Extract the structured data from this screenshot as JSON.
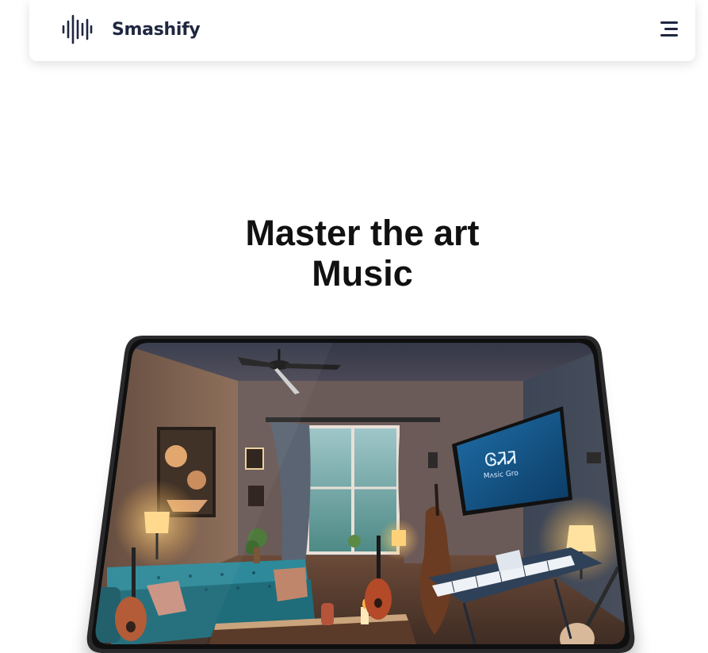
{
  "navbar": {
    "brand": "Smashify",
    "logo_icon": "sound-wave-icon",
    "menu_icon": "hamburger-menu-icon"
  },
  "hero": {
    "title_line1": "Master the art",
    "title_line2": "Music"
  },
  "showcase": {
    "image_subject": "music-room-illustration",
    "tv_text_line1": "ᎶᏘᏘ",
    "tv_text_line2": "Mʌsic Gro"
  },
  "colors": {
    "brand_text": "#1f2740",
    "title_text": "#111111",
    "tablet_frame": "#2a2a2c"
  }
}
